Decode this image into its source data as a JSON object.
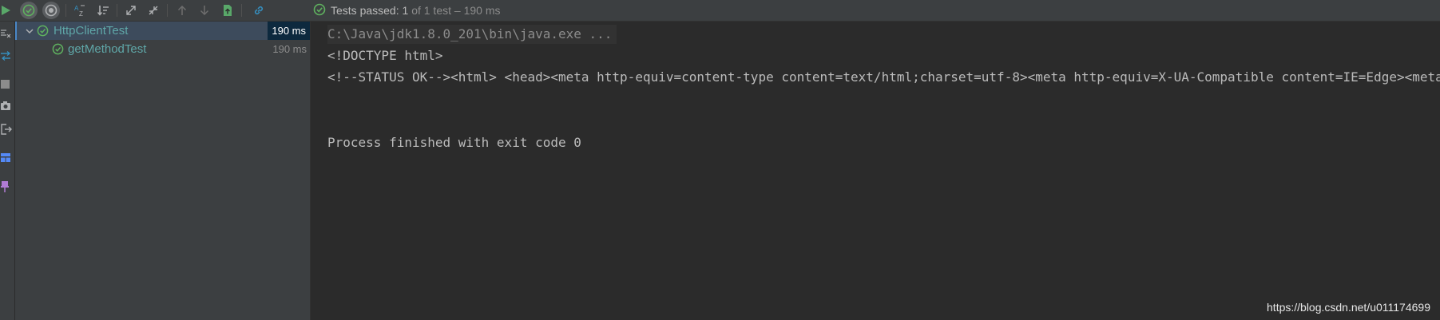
{
  "toolbar": {
    "status_label": "Tests passed:",
    "status_count": "1",
    "status_of": "of 1 test",
    "status_time": "– 190 ms",
    "icons": [
      "rerun-icon",
      "show-passed-icon",
      "show-ignored-icon",
      "sort-alphabetically-icon",
      "sort-by-duration-icon",
      "expand-all-icon",
      "collapse-all-icon",
      "previous-test-icon",
      "next-test-icon",
      "export-results-icon",
      "link-icon"
    ]
  },
  "left_strip": {
    "icons": [
      "format-icon",
      "soft-wrap-icon",
      "stop-icon",
      "camera-icon",
      "exit-icon",
      "layout-icon",
      "pin-icon"
    ]
  },
  "tree": {
    "root": {
      "label": "HttpClientTest",
      "time": "190 ms"
    },
    "children": [
      {
        "label": "getMethodTest",
        "time": "190 ms"
      }
    ]
  },
  "console": {
    "lines": [
      "C:\\Java\\jdk1.8.0_201\\bin\\java.exe ...",
      "<!DOCTYPE html>",
      "<!--STATUS OK--><html> <head><meta http-equiv=content-type content=text/html;charset=utf-8><meta http-equiv=X-UA-Compatible content=IE=Edge><meta",
      "Process finished with exit code 0"
    ]
  },
  "watermark": "https://blog.csdn.net/u011174699",
  "colors": {
    "pass_green": "#5fb15f",
    "accent_blue": "#4a88c7",
    "tree_text": "#5fa7a8"
  }
}
